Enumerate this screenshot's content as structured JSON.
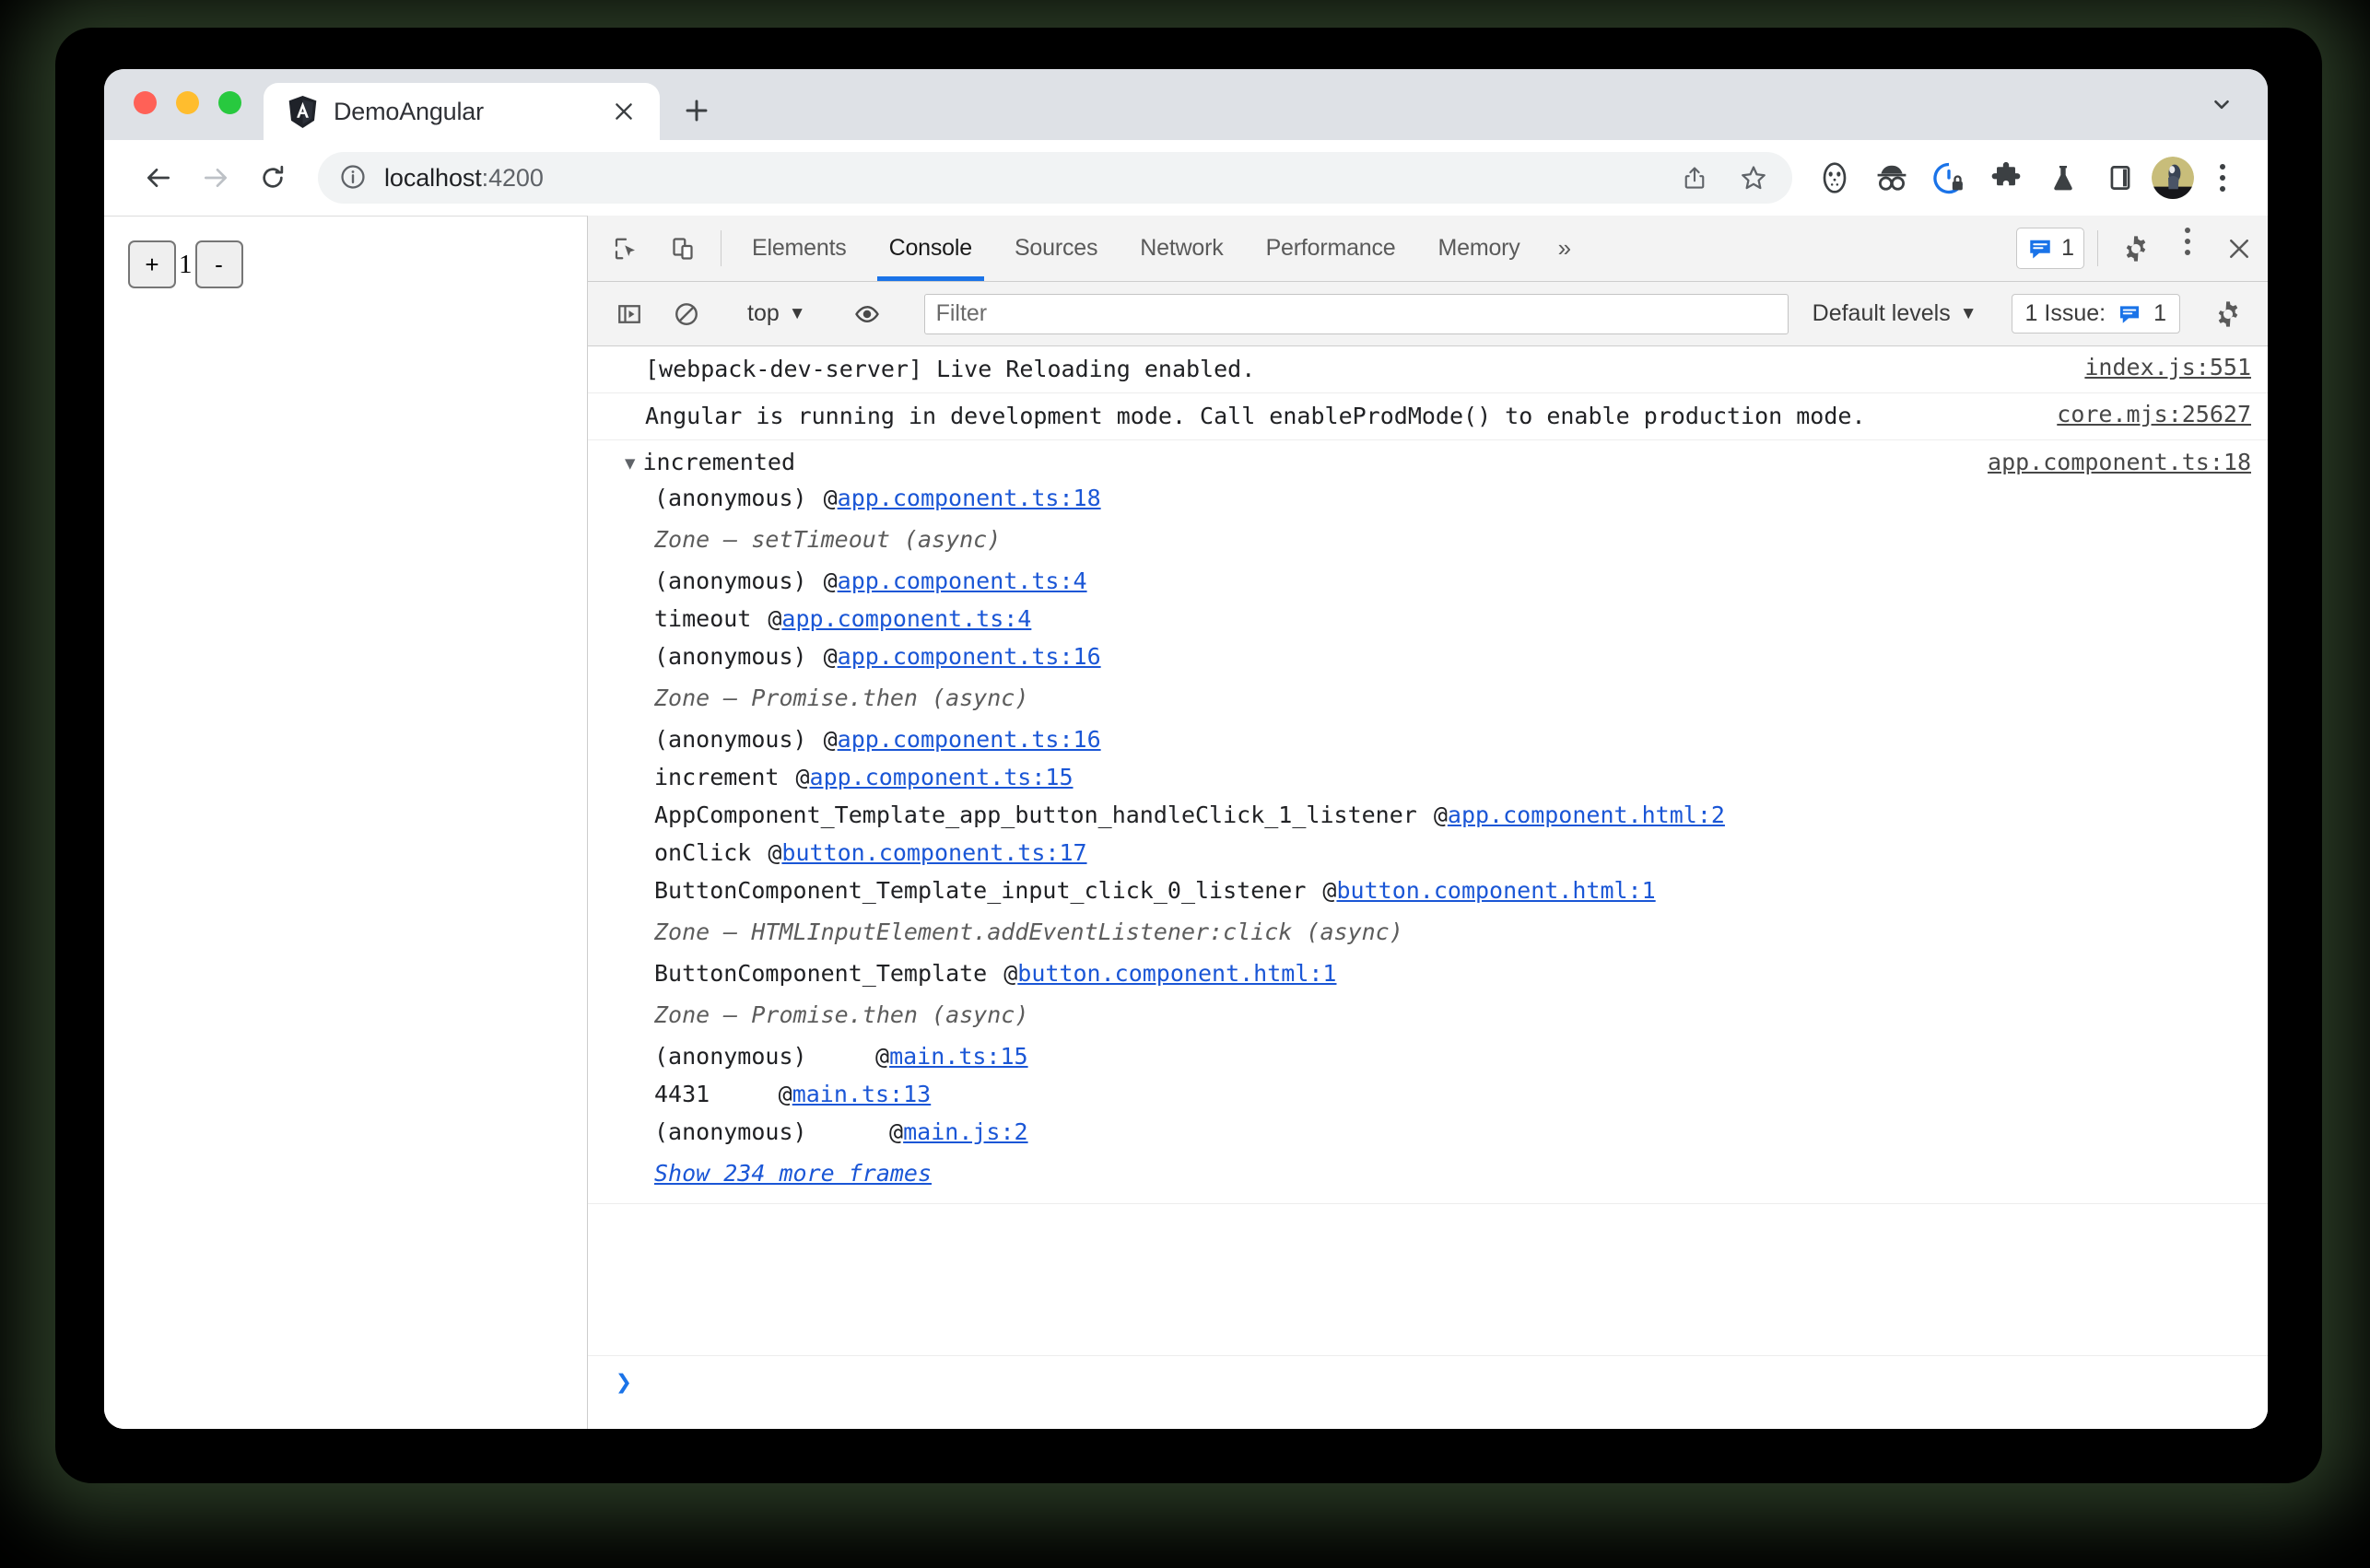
{
  "browser": {
    "tab": {
      "title": "DemoAngular",
      "favicon_icon": "angular-shield-icon",
      "close_icon": "close-icon"
    },
    "new_tab_icon": "plus-icon",
    "tab_search_icon": "chevron-down-icon",
    "nav": {
      "back_icon": "arrow-left-icon",
      "forward_icon": "arrow-right-icon",
      "reload_icon": "reload-icon"
    },
    "omnibox": {
      "info_icon": "info-circle-icon",
      "host": "localhost",
      "port": ":4200",
      "share_icon": "share-icon",
      "bookmark_icon": "star-icon"
    },
    "extensions": [
      {
        "name": "hockey-mask-icon"
      },
      {
        "name": "incognito-glasses-icon"
      },
      {
        "name": "shield-lock-icon"
      },
      {
        "name": "puzzle-piece-icon"
      },
      {
        "name": "flask-icon"
      },
      {
        "name": "sidebar-panel-icon"
      }
    ],
    "avatar_icon": "user-avatar",
    "menu_icon": "kebab-menu-icon"
  },
  "page": {
    "increment_label": "+",
    "counter_value": "1",
    "decrement_label": "-"
  },
  "devtools": {
    "inspect_icon": "inspect-element-icon",
    "device_icon": "device-toolbar-icon",
    "tabs": [
      {
        "label": "Elements",
        "active": false
      },
      {
        "label": "Console",
        "active": true
      },
      {
        "label": "Sources",
        "active": false
      },
      {
        "label": "Network",
        "active": false
      },
      {
        "label": "Performance",
        "active": false
      },
      {
        "label": "Memory",
        "active": false
      }
    ],
    "more_tabs_label": "»",
    "issues_badge": {
      "icon": "message-badge-icon",
      "count": "1"
    },
    "settings_icon": "gear-icon",
    "more_options_icon": "kebab-menu-icon",
    "close_icon": "close-icon",
    "toolbar": {
      "sidebar_icon": "console-sidebar-icon",
      "clear_icon": "clear-console-icon",
      "context_label": "top",
      "context_caret": "▼",
      "eye_icon": "live-expression-eye-icon",
      "filter_placeholder": "Filter",
      "levels_label": "Default levels",
      "levels_caret": "▼",
      "issues_label": "1 Issue:",
      "issues_icon": "message-badge-icon",
      "issues_count": "1",
      "settings_icon": "gear-icon"
    },
    "console": {
      "messages": [
        {
          "text": "[webpack-dev-server] Live Reloading enabled.",
          "source": "index.js:551"
        },
        {
          "text": "Angular is running in development mode. Call enableProdMode() to enable production mode.",
          "source": "core.mjs:25627"
        }
      ],
      "group": {
        "triangle": "▼",
        "title": "incremented",
        "source": "app.component.ts:18",
        "at_symbol": "@",
        "entries": [
          {
            "type": "frame",
            "fn": "(anonymous)",
            "link": "app.component.ts:18"
          },
          {
            "type": "zone",
            "label": "Zone – setTimeout (async)"
          },
          {
            "type": "frame",
            "fn": "(anonymous)",
            "link": "app.component.ts:4"
          },
          {
            "type": "frame",
            "fn": "timeout",
            "link": "app.component.ts:4"
          },
          {
            "type": "frame",
            "fn": "(anonymous)",
            "link": "app.component.ts:16"
          },
          {
            "type": "zone",
            "label": "Zone – Promise.then (async)"
          },
          {
            "type": "frame",
            "fn": "(anonymous)",
            "link": "app.component.ts:16"
          },
          {
            "type": "frame",
            "fn": "increment",
            "link": "app.component.ts:15"
          },
          {
            "type": "frame",
            "fn": "AppComponent_Template_app_button_handleClick_1_listener",
            "link": "app.component.html:2"
          },
          {
            "type": "frame",
            "fn": "onClick",
            "link": "button.component.ts:17"
          },
          {
            "type": "frame",
            "fn": "ButtonComponent_Template_input_click_0_listener",
            "link": "button.component.html:1"
          },
          {
            "type": "zone",
            "label": "Zone – HTMLInputElement.addEventListener:click (async)"
          },
          {
            "type": "frame",
            "fn": "ButtonComponent_Template",
            "link": "button.component.html:1"
          },
          {
            "type": "zone",
            "label": "Zone – Promise.then (async)"
          },
          {
            "type": "frame",
            "fn": "(anonymous)",
            "link": "main.ts:15"
          },
          {
            "type": "frame",
            "fn": "4431",
            "link": "main.ts:13"
          },
          {
            "type": "frame",
            "fn": "(anonymous)",
            "link": "main.js:2"
          }
        ],
        "show_more": "Show 234 more frames"
      },
      "prompt_chevron": "❯"
    }
  },
  "colors": {
    "accent_blue": "#1a73e8",
    "link_blue": "#1a56d6",
    "tabstrip_bg": "#dee1e6",
    "devtools_bg": "#f3f3f3"
  }
}
